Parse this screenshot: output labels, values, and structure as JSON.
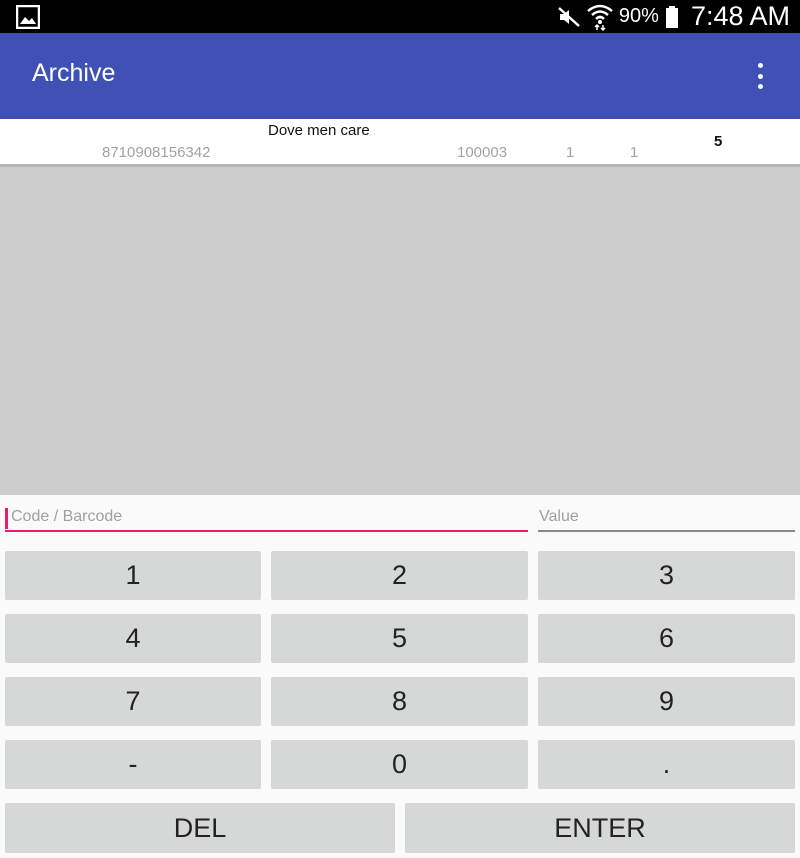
{
  "status_bar": {
    "battery_percent": "90%",
    "time": "7:48 AM",
    "icons": [
      "gallery-icon",
      "mute-icon",
      "wifi-icon",
      "battery-icon"
    ]
  },
  "app_bar": {
    "title": "Archive",
    "menu_icon": "overflow-menu-icon",
    "color": "#3f51b5"
  },
  "list": {
    "items": [
      {
        "name": "Dove men care",
        "barcode": "8710908156342",
        "code": "100003",
        "qty1": "1",
        "qty2": "1",
        "total": "5"
      }
    ]
  },
  "inputs": {
    "code_placeholder": "Code / Barcode",
    "code_value": "",
    "value_placeholder": "Value",
    "value_value": "",
    "accent_color": "#e91e63"
  },
  "keypad": {
    "keys": [
      "1",
      "2",
      "3",
      "4",
      "5",
      "6",
      "7",
      "8",
      "9",
      "-",
      "0",
      "."
    ],
    "del_label": "DEL",
    "enter_label": "ENTER"
  }
}
